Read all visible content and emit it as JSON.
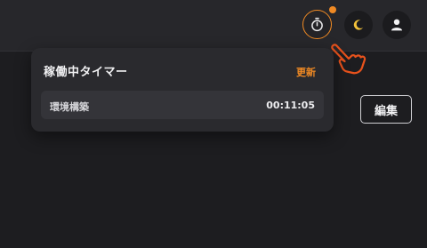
{
  "header": {
    "timer_icon": "stopwatch-icon",
    "theme_icon": "moon-icon",
    "user_icon": "user-icon",
    "accent_color": "#f08a24"
  },
  "timer_popover": {
    "title": "稼働中タイマー",
    "refresh_label": "更新",
    "timers": [
      {
        "name": "環境構築",
        "elapsed": "00:11:05"
      }
    ]
  },
  "main": {
    "edit_label": "編集"
  }
}
